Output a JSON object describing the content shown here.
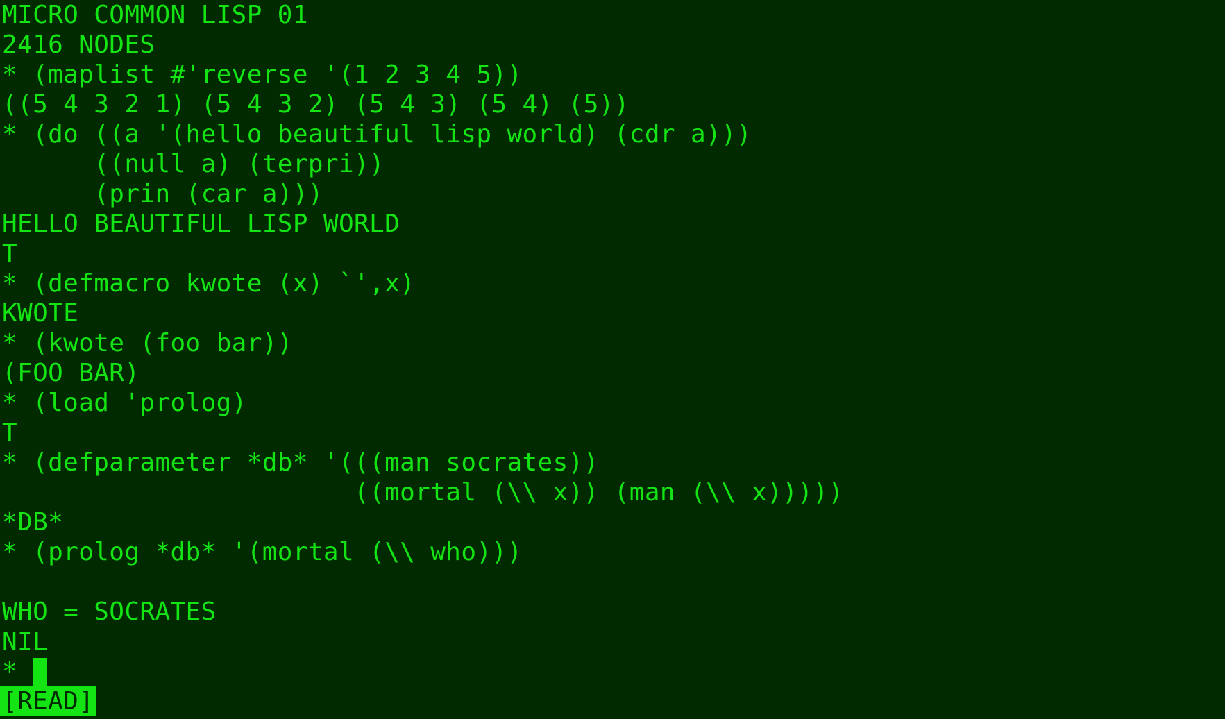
{
  "terminal": {
    "lines": [
      "MICRO COMMON LISP 01",
      "2416 NODES",
      "* (maplist #'reverse '(1 2 3 4 5))",
      "((5 4 3 2 1) (5 4 3 2) (5 4 3) (5 4) (5))",
      "* (do ((a '(hello beautiful lisp world) (cdr a)))",
      "      ((null a) (terpri))",
      "      (prin (car a)))",
      "HELLO BEAUTIFUL LISP WORLD",
      "T",
      "* (defmacro kwote (x) `',x)",
      "KWOTE",
      "* (kwote (foo bar))",
      "(FOO BAR)",
      "* (load 'prolog)",
      "T",
      "* (defparameter *db* '(((man socrates))",
      "                       ((mortal (\\\\ x)) (man (\\\\ x)))))",
      "*DB*",
      "* (prolog *db* '(mortal (\\\\ who)))",
      "",
      "WHO = SOCRATES",
      "NIL"
    ],
    "prompt": "* ",
    "status": "[READ]"
  },
  "colors": {
    "background": "#012a00",
    "foreground": "#14e414"
  }
}
